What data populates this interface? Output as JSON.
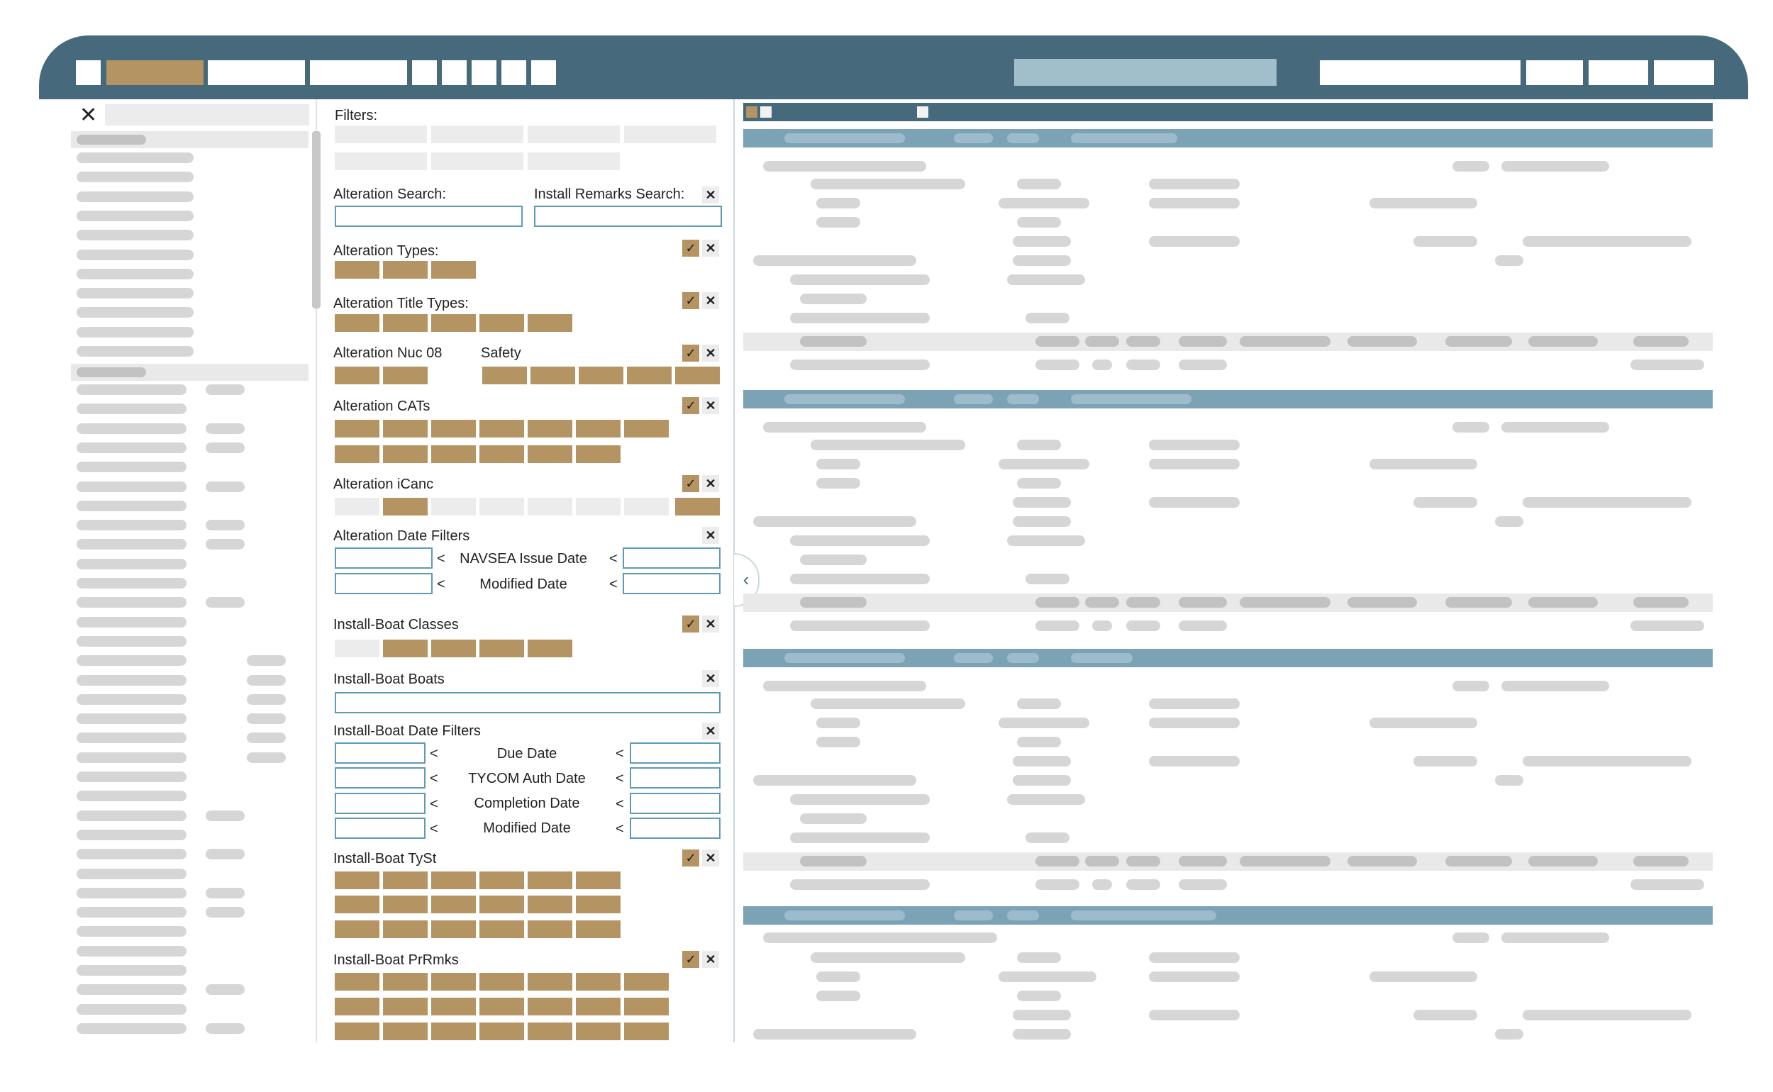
{
  "colors": {
    "topbar": "#466a7c",
    "accent_gold": "#b39462",
    "search_bg": "#a1bfcb",
    "group_header": "#7ca3b5",
    "input_border": "#5e9ab5",
    "placeholder_gray": "#d6d6d6"
  },
  "icons": {
    "sidebar_close": "✕",
    "check": "✓",
    "clear": "✕",
    "collapse": "‹"
  },
  "filters": {
    "title": "Filters:",
    "alteration_search_label": "Alteration Search:",
    "install_remarks_search_label": "Install Remarks Search:",
    "alteration_search_value": "",
    "install_remarks_search_value": "",
    "alteration_types_label": "Alteration Types:",
    "alteration_title_types_label": "Alteration Title Types:",
    "alteration_nuc08_label": "Alteration Nuc 08",
    "safety_label": "Safety",
    "alteration_cats_label": "Alteration CATs",
    "alteration_icanc_label": "Alteration iCanc",
    "alteration_date_filters_label": "Alteration Date Filters",
    "navsea_issue_date_label": "NAVSEA Issue Date",
    "modified_date_label": "Modified Date",
    "install_boat_classes_label": "Install-Boat Classes",
    "install_boat_boats_label": "Install-Boat Boats",
    "install_boat_boats_value": "",
    "install_boat_date_filters_label": "Install-Boat Date Filters",
    "due_date_label": "Due Date",
    "tycom_auth_date_label": "TYCOM Auth Date",
    "completion_date_label": "Completion Date",
    "install_modified_date_label": "Modified Date",
    "install_boat_tyst_label": "Install-Boat TySt",
    "install_boat_prmks_label": "Install-Boat PrRmks",
    "less_than": "<"
  }
}
